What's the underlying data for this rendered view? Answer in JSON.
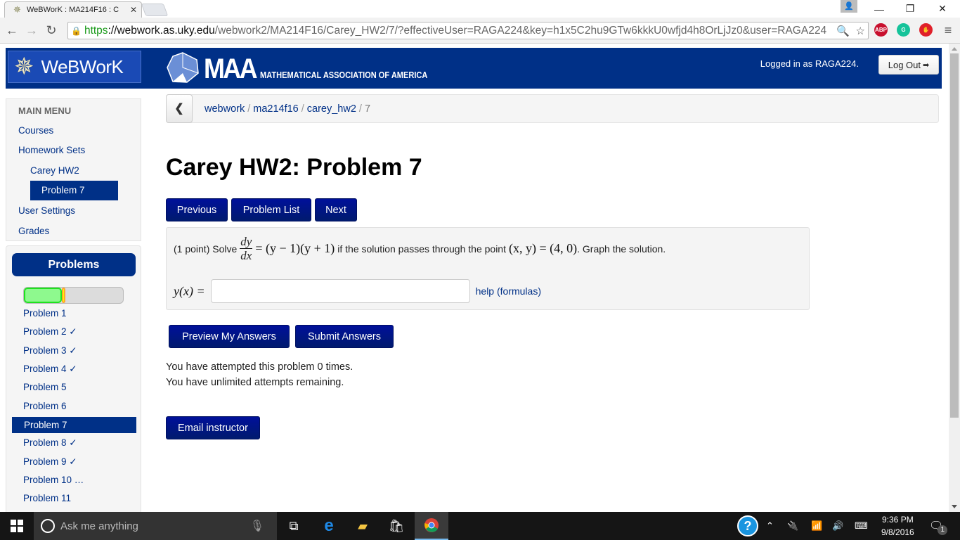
{
  "browser": {
    "tab_title": "WeBWorK : MA214F16 : C",
    "url_scheme": "https",
    "url_host": "://webwork.as.uky.edu",
    "url_path": "/webwork2/MA214F16/Carey_HW2/7/?effectiveUser=RAGA224&key=h1x5C2hu9GTw6kkkU0wfjd4h8OrLjJz0&user=RAGA224",
    "extensions": [
      "adblock-plus-icon",
      "grammarly-icon",
      "ublock-icon"
    ],
    "ext_labels": {
      "abp": "ABP"
    }
  },
  "header": {
    "app_name": "WeBWorK",
    "maa_big": "MAA",
    "maa_sub": "MATHEMATICAL ASSOCIATION OF AMERICA",
    "login_text": "Logged in as RAGA224.",
    "logout_label": "Log Out"
  },
  "main_menu": {
    "title": "MAIN MENU",
    "items": [
      {
        "label": "Courses"
      },
      {
        "label": "Homework Sets"
      },
      {
        "label": "Carey HW2"
      },
      {
        "label": "Problem 7",
        "active": true
      },
      {
        "label": "User Settings"
      },
      {
        "label": "Grades"
      }
    ]
  },
  "problems_panel": {
    "title": "Problems",
    "progress": {
      "correct_pct": 38,
      "incorrect_pct": 4
    },
    "items": [
      {
        "label": "Problem 1"
      },
      {
        "label": "Problem 2 ✓"
      },
      {
        "label": "Problem 3 ✓"
      },
      {
        "label": "Problem 4 ✓"
      },
      {
        "label": "Problem 5"
      },
      {
        "label": "Problem 6"
      },
      {
        "label": "Problem 7",
        "active": true
      },
      {
        "label": "Problem 8 ✓"
      },
      {
        "label": "Problem 9 ✓"
      },
      {
        "label": "Problem 10 …"
      },
      {
        "label": "Problem 11"
      }
    ]
  },
  "breadcrumb": {
    "items": [
      "webwork",
      "ma214f16",
      "carey_hw2"
    ],
    "current": "7",
    "separator": "/"
  },
  "page_title": "Carey HW2: Problem 7",
  "nav_buttons": {
    "previous": "Previous",
    "problem_list": "Problem List",
    "next": "Next"
  },
  "problem": {
    "points": "(1 point) Solve",
    "frac_num": "dy",
    "frac_den": "dx",
    "equation_rhs": "= (y − 1)(y + 1)",
    "middle_text": "if the solution passes through the point",
    "point": "(x, y) = (4, 0)",
    "end_text": ". Graph the solution.",
    "answer_label": "y(x) =",
    "answer_value": "",
    "help_link": "help (formulas)"
  },
  "actions": {
    "preview": "Preview My Answers",
    "submit": "Submit Answers",
    "email": "Email instructor"
  },
  "messages": {
    "attempts": "You have attempted this problem 0 times.",
    "remaining": "You have unlimited attempts remaining."
  },
  "taskbar": {
    "search_placeholder": "Ask me anything",
    "time": "9:36 PM",
    "date": "9/8/2016",
    "notification_count": "1"
  },
  "colors": {
    "brand": "#003087",
    "button": "#00109a",
    "link": "#003087",
    "correct": "#8ef98e",
    "incorrect": "#ffff00"
  }
}
